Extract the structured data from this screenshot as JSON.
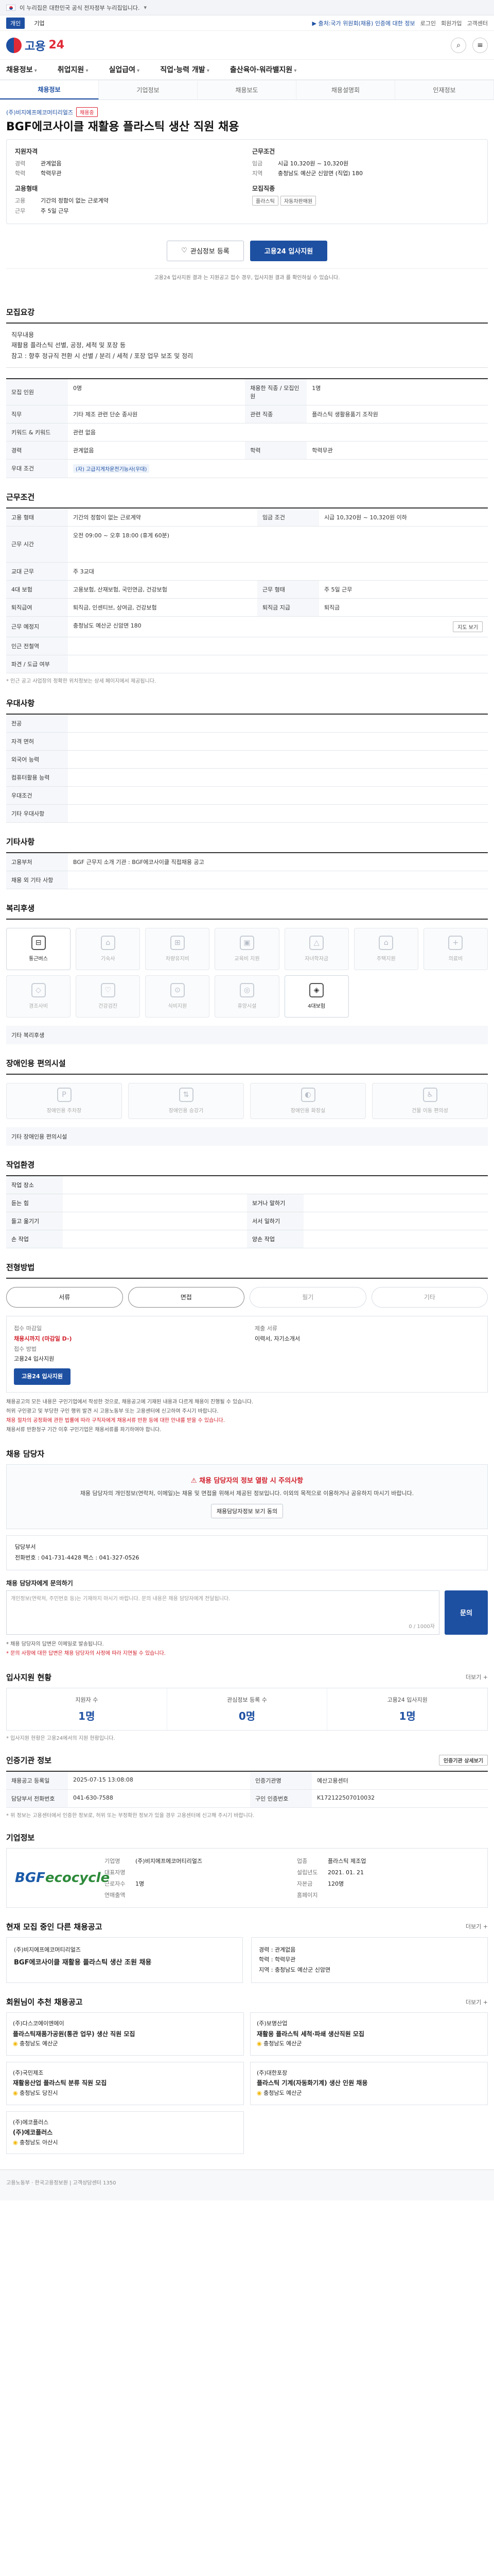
{
  "gov_banner": {
    "text": "이 누리집은 대한민국 공식 전자정부 누리집입니다."
  },
  "util": {
    "left": [
      "개인",
      "기업"
    ],
    "right": [
      "로그인",
      "회원가입",
      "고객센터"
    ],
    "notice": "▶ 출처:국가 위원회(채용) 인증에 대한 정보"
  },
  "header": {
    "logo_prefix": "고용",
    "logo_num": "24"
  },
  "gnb": [
    "채용정보",
    "취업지원",
    "실업급여",
    "직업·능력 개발",
    "출산육아·워라밸지원"
  ],
  "subtabs": [
    "채용정보",
    "기업정보",
    "채용보도",
    "채용설명회",
    "인재정보"
  ],
  "title": {
    "company": "(주)비지에프에코머티리얼즈",
    "badge": "채용중",
    "text": "BGF에코사이클 재활용 플라스틱 생산 직원 채용"
  },
  "summary": {
    "left_head": "지원자격",
    "rows_left": [
      {
        "k": "경력",
        "v": "관계없음"
      },
      {
        "k": "학력",
        "v": "학력무관"
      }
    ],
    "left_sub_head": "고용형태",
    "rows_left2": [
      {
        "k": "고용",
        "v": "기간의 정함이 없는 근로계약"
      },
      {
        "k": "근무",
        "v": "주 5일 근무"
      }
    ],
    "right_head": "근무조건",
    "rows_right": [
      {
        "k": "임금",
        "v": "시급 10,320원 ~ 10,320원"
      },
      {
        "k": "지역",
        "v": "충청남도 예산군 신암면 (직업) 180"
      }
    ],
    "right_sub_head": "모집직종",
    "tags": [
      "플라스틱",
      "자동차판매원"
    ]
  },
  "actions": {
    "scrap": "관심정보 등록",
    "apply": "고용24 입사지원"
  },
  "note": "고용24 입사지원 결과 는 지원공고 접수 경우, 입사지원 결과 를 확인하실 수 있습니다.",
  "job_content": {
    "title": "모집요강",
    "lines": [
      "직무내용",
      "재활용 플라스틱 선별, 공정, 세척 및 포장 등",
      "참고 : 향후 정규직 전환 시 선별 / 분리 / 세척 / 포장 업무 보조 및 정리"
    ]
  },
  "job_table": [
    {
      "k": "모집 인원",
      "v": "0명",
      "k2": "채용한 직종 / 모집인원",
      "v2": "1명"
    },
    {
      "k": "직무",
      "v": "기타 제조 관련 단순 종사원",
      "k2": "관련 직종",
      "v2": "플라스틱 생활용품기 조작원"
    },
    {
      "k": "키워드 & 키워드",
      "v": "관련 없음",
      "k2": "",
      "v2": ""
    },
    {
      "k": "경력",
      "v": "관계없음",
      "k2": "학력",
      "v2": "학력무관"
    },
    {
      "k": "우대 조건",
      "v": "(자) 고급지게차운전기능사(우대)",
      "k2": "",
      "v2": ""
    }
  ],
  "work_cond": {
    "title": "근무조건",
    "rows": [
      {
        "k": "고용 형태",
        "v": "기간의 정함이 없는 근로계약",
        "k2": "임금 조건",
        "v2": "시급 10,320원 ~ 10,320원 이하"
      },
      {
        "k": "근무 시간",
        "v": "오전 09:00 ~ 오후 18:00 (휴게 60분)",
        "k2": "",
        "v2": ""
      },
      {
        "k": "교대 근무",
        "v": "주 3교대",
        "k2": "",
        "v2": ""
      },
      {
        "k": "4대 보험",
        "v": "고용보험, 산재보험, 국민연금, 건강보험",
        "k2": "근무 형태",
        "v2": "주 5일 근무"
      },
      {
        "k": "퇴직급여",
        "v": "퇴직금, 인센티브, 상여금, 건강보험",
        "k2": "퇴직금 지급",
        "v2": "퇴직금"
      },
      {
        "k": "근무 예정지",
        "v": "충청남도 예산군 신암면 180",
        "k2": "",
        "v2": ""
      },
      {
        "k": "인근 전철역",
        "v": "",
        "k2": "",
        "v2": ""
      },
      {
        "k": "파견 / 도급 여부",
        "v": "",
        "k2": "",
        "v2": ""
      }
    ],
    "map_btn": "지도 보기",
    "footnote": "* 인근 공고 사업장의 정확한 위치정보는 상세 페이지에서 제공됩니다."
  },
  "pref": {
    "title": "우대사항",
    "rows": [
      {
        "k": "전공",
        "v": ""
      },
      {
        "k": "자격 면허",
        "v": ""
      },
      {
        "k": "외국어 능력",
        "v": ""
      },
      {
        "k": "컴퓨터활용 능력",
        "v": ""
      },
      {
        "k": "우대조건",
        "v": ""
      },
      {
        "k": "기타 우대사항",
        "v": ""
      }
    ]
  },
  "extra": {
    "title": "기타사항",
    "rows": [
      {
        "k": "고용부처",
        "v": "BGF 근무지 소개 기관 : BGF에코사이클 직접채용 공고"
      },
      {
        "k": "채용 외 기타 사항",
        "v": ""
      }
    ]
  },
  "welfare": {
    "title": "복리후생",
    "items": [
      {
        "label": "통근버스",
        "icon": "bus-icon",
        "glyph": "⊟",
        "on": true
      },
      {
        "label": "기숙사",
        "icon": "bed-icon",
        "glyph": "⌂",
        "on": false
      },
      {
        "label": "차량유지비",
        "icon": "car-icon",
        "glyph": "⊞",
        "on": false
      },
      {
        "label": "교육비 지원",
        "icon": "book-icon",
        "glyph": "▣",
        "on": false
      },
      {
        "label": "자녀학자금",
        "icon": "cap-icon",
        "glyph": "△",
        "on": false
      },
      {
        "label": "주택지원",
        "icon": "house-icon",
        "glyph": "⌂",
        "on": false
      },
      {
        "label": "의료비",
        "icon": "medical-icon",
        "glyph": "+",
        "on": false
      },
      {
        "label": "경조사비",
        "icon": "gift-icon",
        "glyph": "◇",
        "on": false
      },
      {
        "label": "건강검진",
        "icon": "health-icon",
        "glyph": "♡",
        "on": false
      },
      {
        "label": "식비지원",
        "icon": "meal-icon",
        "glyph": "⊙",
        "on": false
      },
      {
        "label": "휴양시설",
        "icon": "rest-icon",
        "glyph": "◎",
        "on": false
      },
      {
        "label": "4대보험",
        "icon": "shield-icon",
        "glyph": "◈",
        "on": true
      }
    ],
    "note_k": "기타 복리후생",
    "note_v": ""
  },
  "disability": {
    "title": "장애인용 편의시설",
    "items": [
      "장애인용 주차장",
      "장애인용 승강기",
      "장애인용 화장실",
      "건물 이동 편의성"
    ],
    "note_k": "기타 장애인용 편의시설",
    "note_v": ""
  },
  "env": {
    "title": "작업환경",
    "rows": [
      {
        "k": "작업 장소",
        "v": "",
        "k2": "",
        "v2": ""
      },
      {
        "k": "듣는 힘",
        "v": "",
        "k2": "보거나 말하기",
        "v2": ""
      },
      {
        "k": "들고 옮기기",
        "v": "",
        "k2": "서서 일하기",
        "v2": ""
      },
      {
        "k": "손 작업",
        "v": "",
        "k2": "양손 작업",
        "v2": ""
      }
    ]
  },
  "process": {
    "title": "전형방법",
    "steps": [
      "서류",
      "면접",
      "필기",
      "기타"
    ],
    "on": [
      true,
      true,
      false,
      false
    ],
    "apply_head": "접수 마감일",
    "deadline": "채용시까지 (마감일 D-)",
    "apply_way_head": "접수 방법",
    "apply_way": "고용24 입사지원",
    "docs_head": "제출 서류",
    "docs": "이력서, 자기소개서",
    "apply_btn": "고용24 입사지원",
    "bullets": [
      "채용공고의 모든 내용은 구인기업에서 작성한 것으로, 채용공고에 기재된 내용과 다르게 채용이 진행될 수 있습니다.",
      "허위 구인광고 및 부당한 구인 행위 발견 시 고용노동부 또는 고용센터에 신고하여 주시기 바랍니다.",
      "채용 절차의 공정화에 관한 법률에 따라 구직자에게 채용서류 반환 등에 대한 안내를 받을 수 있습니다.",
      "채용서류 반환청구 기간 이후 구인기업은 채용서류를 파기하여야 합니다."
    ]
  },
  "manager": {
    "title": "채용 담당자",
    "warn_title": "채용 담당자의 정보 열람 시 주의사항",
    "warn_text": "채용 담당자의 개인정보(연락처, 이메일)는 채용 및 면접을 위해서 제공된 정보입니다. 이외의 목적으로 이용하거나 공유하지 마시기 바랍니다.",
    "warn_btn": "채용담당자정보 보기 동의",
    "dept_head": "담당부서",
    "tel_line": "전화번호 : 041-731-4428    팩스 : 041-327-0526",
    "inq_label": "채용 담당자에게 문의하기",
    "inq_placeholder": "개인정보(연락처, 주민번호 등)는 기재하지 마시기 바랍니다. 문의 내용은 채용 담당자에게 전달됩니다.",
    "inq_count": "0 / 1000자",
    "inq_btn": "문의",
    "bullets": [
      "* 채용 담당자의 답변은 이메일로 발송됩니다.",
      "* 문의 사항에 대한 답변은 채용 담당자의 사정에 따라 지연될 수 있습니다."
    ]
  },
  "stats": {
    "title": "입사지원 현황",
    "more": "더보기 +",
    "items": [
      {
        "label": "지원자 수",
        "value": "1명"
      },
      {
        "label": "관심정보 등록 수",
        "value": "0명"
      },
      {
        "label": "고용24 입사지원",
        "value": "1명"
      }
    ],
    "note": "* 입사지원 현황은 고용24에서의 지원 현황입니다."
  },
  "recruit_info": {
    "title": "인증기관 정보",
    "btn": "인증기관 상세보기",
    "rows": [
      {
        "k": "채용공고 등록일",
        "v": "2025-07-15 13:08:08",
        "k2": "인증기관명",
        "v2": "예산고용센터"
      },
      {
        "k": "담당부서 전화번호",
        "v": "041-630-7588",
        "k2": "구인 인증번호",
        "v2": "K172122507010032"
      }
    ],
    "note": "* 위 정보는 고용센터에서 인증한 정보로, 허위 또는 부정확한 정보가 있을 경우 고용센터에 신고해 주시기 바랍니다."
  },
  "company": {
    "title": "기업정보",
    "logo_main": "BGF",
    "logo_sub": "ecocycle",
    "rows": [
      {
        "k": "기업명",
        "v": "(주)비지에프에코머티리얼즈"
      },
      {
        "k": "업종",
        "v": "플라스틱 제조업"
      },
      {
        "k": "대표자명",
        "v": ""
      },
      {
        "k": "설립년도",
        "v": "2021. 01. 21"
      },
      {
        "k": "근로자수",
        "v": "1명"
      },
      {
        "k": "자본금",
        "v": "120명"
      },
      {
        "k": "연매출액",
        "v": ""
      },
      {
        "k": "홈페이지",
        "v": ""
      }
    ]
  },
  "others": {
    "title": "현재 모집 중인 다른 채용공고",
    "more": "더보기 +",
    "card_company": "(주)비지에프에코머티리얼즈",
    "card_title": "BGF에코사이클 재활용 플라스틱 생산 조원 채용",
    "card_rows": [
      "경력 : 관계없음",
      "학력 : 학력무관",
      "지역 : 충청남도 예산군 신암면"
    ]
  },
  "recommend": {
    "title": "회원님이 추천 채용공고",
    "more": "더보기 +",
    "items": [
      {
        "company": "(주)다스코에이엔에이",
        "title": "플라스틱재품가공원(통관 업무) 생산 직원 모집",
        "meta": "충청남도 예산군"
      },
      {
        "company": "(주)보명산업",
        "title": "재활용 플라스틱 세척·파쇄 생산직원 모집",
        "meta": "충청남도 예산군"
      },
      {
        "company": "(주)국민제조",
        "title": "재활용산업 플라스틱 분류 직원 모집",
        "meta": "충청남도 당진시"
      },
      {
        "company": "(주)대한포장",
        "title": "플라스틱 기계(자동화기계) 생산 인원 채용",
        "meta": "충청남도 예산군"
      },
      {
        "company": "(주)에코플러스",
        "title": "(주)에코플러스",
        "meta": "충청남도 아산시"
      },
      {
        "company": "",
        "title": "",
        "meta": ""
      }
    ]
  },
  "footer": {
    "text": "고용노동부 · 한국고용정보원 | 고객상담센터 1350"
  }
}
